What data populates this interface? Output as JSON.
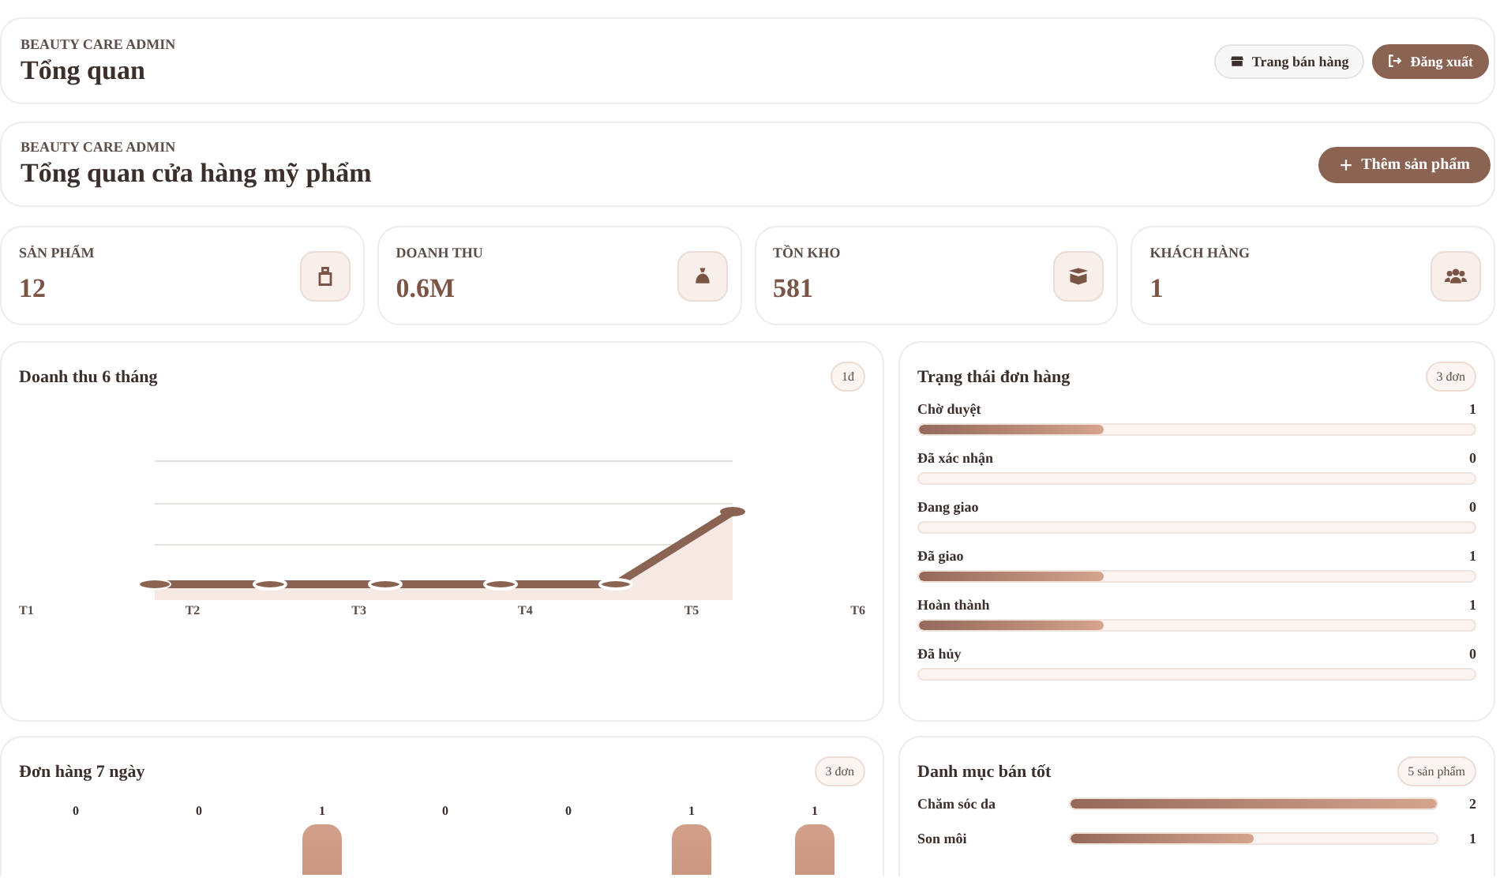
{
  "header": {
    "eyebrow": "BEAUTY CARE ADMIN",
    "title": "Tổng quan",
    "buttons": [
      {
        "label": "Trang bán hàng",
        "kind": "store"
      },
      {
        "label": "Đăng xuất",
        "kind": "logout"
      }
    ]
  },
  "page_header": {
    "eyebrow": "BEAUTY CARE ADMIN",
    "title": "Tổng quan cửa hàng mỹ phẩm",
    "button": {
      "label": "Thêm sản phẩm"
    }
  },
  "stats": [
    {
      "label": "SẢN PHẨM",
      "value": "12",
      "kind": "product"
    },
    {
      "label": "DOANH THU",
      "value": "0.6M",
      "kind": "money"
    },
    {
      "label": "TỒN KHO",
      "value": "581",
      "kind": "stock"
    },
    {
      "label": "KHÁCH HÀNG",
      "value": "1",
      "kind": "customers"
    }
  ],
  "revenue_chart": {
    "title": "Doanh thu 6 tháng",
    "badge": "1đ",
    "x_labels": [
      "T1",
      "T2",
      "T3",
      "T4",
      "T5",
      "T6"
    ]
  },
  "order_status": {
    "title": "Trạng thái đơn hàng",
    "badge": "3 đơn",
    "rows": [
      {
        "label": "Chờ duyệt",
        "count": "1",
        "level": 0.333
      },
      {
        "label": "Đã xác nhận",
        "count": "0",
        "level": 0
      },
      {
        "label": "Đang giao",
        "count": "0",
        "level": 0
      },
      {
        "label": "Đã giao",
        "count": "1",
        "level": 0.333
      },
      {
        "label": "Hoàn thành",
        "count": "1",
        "level": 0.333
      },
      {
        "label": "Đã hủy",
        "count": "0",
        "level": 0
      }
    ]
  },
  "orders_7_days": {
    "title": "Đơn hàng 7 ngày",
    "badge": "3 đơn",
    "days": [
      {
        "count": "0"
      },
      {
        "count": "0"
      },
      {
        "count": "1"
      },
      {
        "count": "0"
      },
      {
        "count": "0"
      },
      {
        "count": "1"
      },
      {
        "count": "1"
      }
    ]
  },
  "top_categories": {
    "title": "Danh mục bán tốt",
    "badge": "5 sản phẩm",
    "rows": [
      {
        "label": "Chăm sóc da",
        "count": "2",
        "level": 1
      },
      {
        "label": "Son môi",
        "count": "1",
        "level": 0.5
      }
    ]
  }
}
